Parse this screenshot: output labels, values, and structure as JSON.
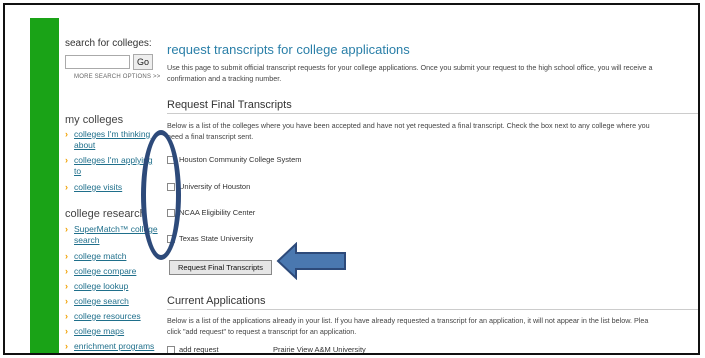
{
  "sidebar": {
    "search_label": "search for colleges:",
    "search_placeholder": "",
    "go_label": "Go",
    "more_search": "MORE SEARCH OPTIONS >>",
    "my_colleges_title": "my colleges",
    "my_colleges": [
      {
        "line1": "colleges I'm thinking",
        "line2": "about"
      },
      {
        "line1": "colleges I'm applying",
        "line2": "to"
      },
      {
        "line1": "college visits",
        "line2": ""
      }
    ],
    "research_title": "college research",
    "research": [
      {
        "line1": "SuperMatch™ college",
        "line2": "search"
      },
      {
        "line1": "college match",
        "line2": ""
      },
      {
        "line1": "college compare",
        "line2": ""
      },
      {
        "line1": "college lookup",
        "line2": ""
      },
      {
        "line1": "college search",
        "line2": ""
      },
      {
        "line1": "college resources",
        "line2": ""
      },
      {
        "line1": "college maps",
        "line2": ""
      },
      {
        "line1": "enrichment programs",
        "line2": ""
      }
    ]
  },
  "main": {
    "title": "request transcripts for college applications",
    "intro_line1": "Use this page to submit official transcript requests for your college applications. Once you submit your request to the high school office, you will receive a",
    "intro_line2": "confirmation and a tracking number.",
    "final_heading": "Request Final Transcripts",
    "final_para_line1": "Below is a list of the colleges where you have been accepted and have not yet requested a final transcript. Check the box next to any college where you",
    "final_para_line2": "need a final transcript sent.",
    "colleges": [
      "Houston Community College System",
      "University of Houston",
      "NCAA Eligibility Center",
      "Texas State University"
    ],
    "request_button": "Request Final Transcripts",
    "current_heading": "Current Applications",
    "current_para_line1": "Below is a list of the applications already in your list. If you have already requested a transcript for an application, it will not appear in the list below. Plea",
    "current_para_line2": "click \"add request\" to request a transcript for an application.",
    "add_request_label": "add request",
    "application_name": "Prairie View A&M University"
  },
  "annotation_colors": {
    "highlight": "#2d4a7a",
    "arrow": "#4a78b0"
  }
}
